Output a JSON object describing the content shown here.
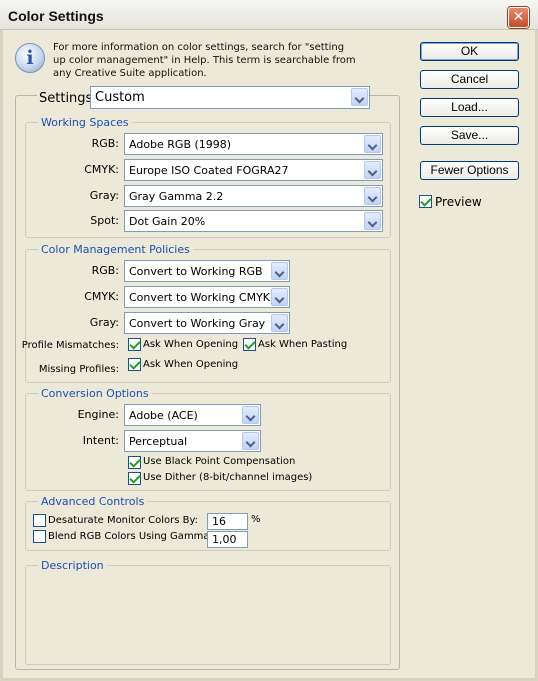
{
  "window": {
    "title": "Color Settings",
    "close_glyph": "✕",
    "info_glyph": "i",
    "info_text": "For more information on color settings, search for \"setting up color management\" in Help. This term is searchable from any Creative Suite application."
  },
  "buttons": {
    "ok": "OK",
    "cancel": "Cancel",
    "load": "Load...",
    "save": "Save...",
    "fewer_options": "Fewer Options"
  },
  "preview": {
    "label": "Preview",
    "checked": true
  },
  "settings": {
    "label": "Settings:",
    "value": "Custom"
  },
  "working_spaces": {
    "title": "Working Spaces",
    "rgb": {
      "label": "RGB:",
      "value": "Adobe RGB (1998)"
    },
    "cmyk": {
      "label": "CMYK:",
      "value": "Europe ISO Coated FOGRA27"
    },
    "gray": {
      "label": "Gray:",
      "value": "Gray Gamma 2.2"
    },
    "spot": {
      "label": "Spot:",
      "value": "Dot Gain 20%"
    }
  },
  "policies": {
    "title": "Color Management Policies",
    "rgb": {
      "label": "RGB:",
      "value": "Convert to Working RGB"
    },
    "cmyk": {
      "label": "CMYK:",
      "value": "Convert to Working CMYK"
    },
    "gray": {
      "label": "Gray:",
      "value": "Convert to Working Gray"
    },
    "profile_mismatches": {
      "label": "Profile Mismatches:",
      "ask_opening": {
        "label": "Ask When Opening",
        "checked": true
      },
      "ask_pasting": {
        "label": "Ask When Pasting",
        "checked": true
      }
    },
    "missing_profiles": {
      "label": "Missing Profiles:",
      "ask_opening": {
        "label": "Ask When Opening",
        "checked": true
      }
    }
  },
  "conversion": {
    "title": "Conversion Options",
    "engine": {
      "label": "Engine:",
      "value": "Adobe (ACE)"
    },
    "intent": {
      "label": "Intent:",
      "value": "Perceptual"
    },
    "black_point": {
      "label": "Use Black Point Compensation",
      "checked": true
    },
    "dither": {
      "label": "Use Dither (8-bit/channel images)",
      "checked": true
    }
  },
  "advanced": {
    "title": "Advanced Controls",
    "desaturate": {
      "label": "Desaturate Monitor Colors By:",
      "value": "16",
      "unit": "%",
      "checked": false
    },
    "blend": {
      "label": "Blend RGB Colors Using Gamma:",
      "value": "1,00",
      "checked": false
    }
  },
  "description": {
    "title": "Description"
  }
}
